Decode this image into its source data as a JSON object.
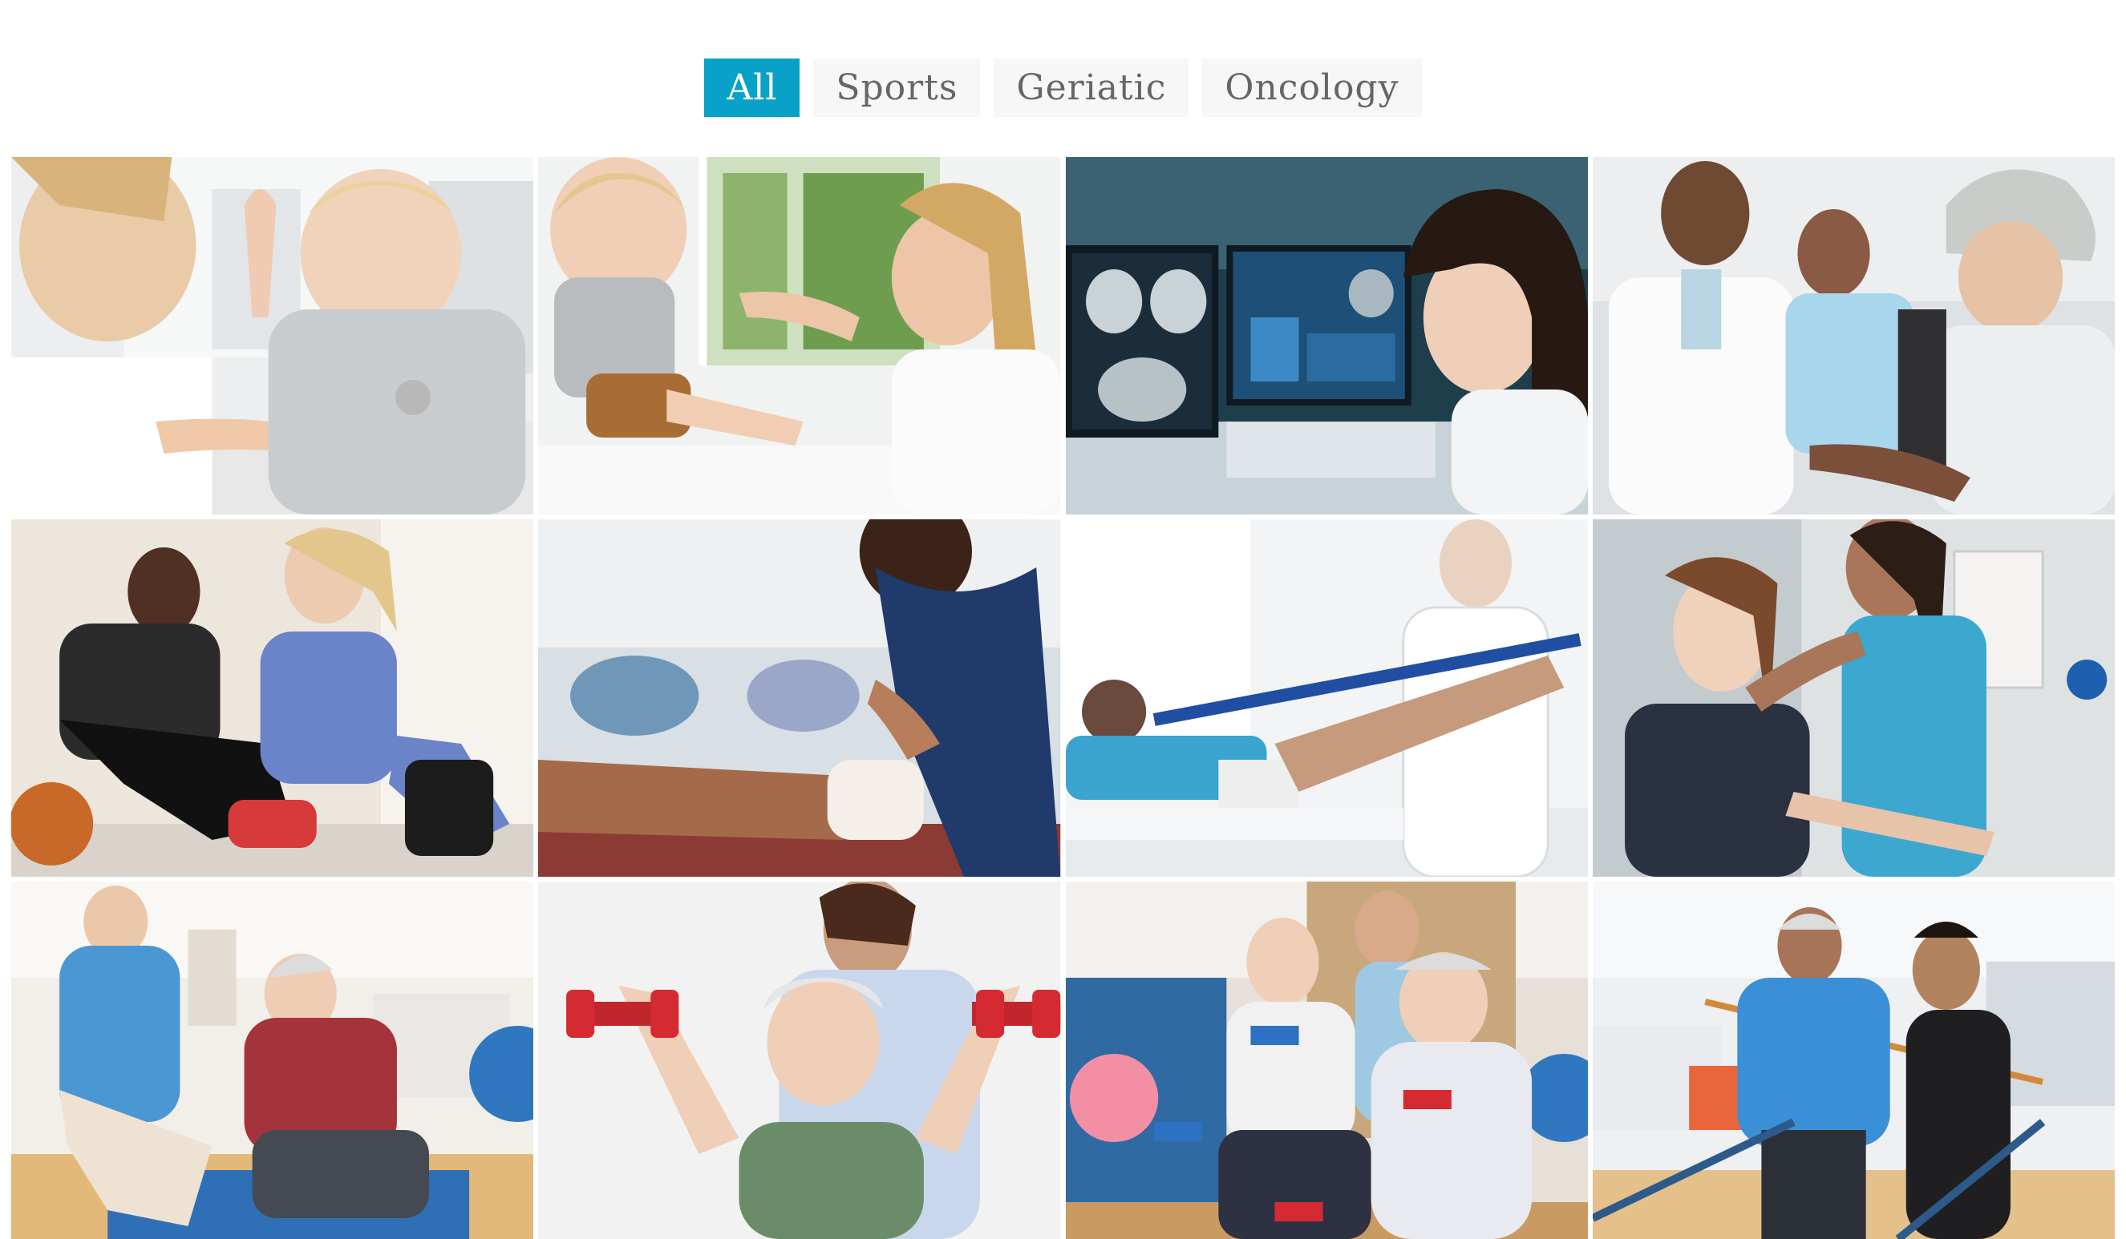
{
  "filters": [
    {
      "label": "All",
      "active": true
    },
    {
      "label": "Sports",
      "active": false
    },
    {
      "label": "Geriatic",
      "active": false
    },
    {
      "label": "Oncology",
      "active": false
    }
  ],
  "gallery": {
    "items": [
      {
        "subject": "doctor-with-stethoscope-examining-baby",
        "category": "all"
      },
      {
        "subject": "therapist-stretching-toddler-arm",
        "category": "all"
      },
      {
        "subject": "radiologist-reviewing-ct-scans",
        "category": "oncology"
      },
      {
        "subject": "doctor-consulting-patient-in-headscarf",
        "category": "oncology"
      },
      {
        "subject": "therapist-treating-ankle-of-athlete-with-basketball",
        "category": "sports"
      },
      {
        "subject": "therapist-wrapping-ankle-bandage",
        "category": "sports"
      },
      {
        "subject": "doctor-assisting-resistance-band-leg-exercise",
        "category": "sports"
      },
      {
        "subject": "therapist-stretching-shoulder-of-woman",
        "category": "sports"
      },
      {
        "subject": "nurse-with-clipboard-assessing-elderly-man-on-mat",
        "category": "geriatic"
      },
      {
        "subject": "senior-woman-lifting-red-dumbbells",
        "category": "geriatic"
      },
      {
        "subject": "seniors-exercising-with-dumbbells-in-gym",
        "category": "geriatic"
      },
      {
        "subject": "elderly-man-walking-parallel-bars-with-therapist",
        "category": "geriatic"
      }
    ]
  }
}
